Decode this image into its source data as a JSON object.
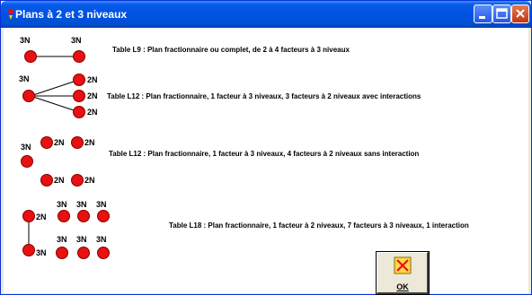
{
  "window": {
    "title": "Plans à 2 et 3 niveaux",
    "title_bar_color": "#0053e4",
    "buttons": [
      "minimize-icon",
      "maximize-icon",
      "close-icon"
    ]
  },
  "node_color": "#e81010",
  "tables": [
    {
      "description": "Table L9 : Plan  fractionnaire ou complet, de 2 à 4 facteurs à 3 niveaux",
      "labels": [
        "3N",
        "3N"
      ]
    },
    {
      "description": "Table L12 : Plan fractionnaire, 1 facteur à 3 niveaux, 3 facteurs à 2 niveaux avec interactions",
      "labels": [
        "3N",
        "2N",
        "2N",
        "2N"
      ]
    },
    {
      "description": "Table L12 : Plan fractionnaire, 1 facteur à 3 niveaux, 4 facteurs à 2 niveaux sans interaction",
      "labels": [
        "3N",
        "2N",
        "2N",
        "2N",
        "2N"
      ]
    },
    {
      "description": "Table L18 : Plan fractionnaire, 1 facteur à 2 niveaux, 7 facteurs à 3 niveaux, 1 interaction",
      "labels": [
        "2N",
        "3N",
        "3N",
        "3N",
        "3N",
        "3N",
        "3N",
        "3N"
      ]
    }
  ],
  "ok_button": {
    "label": "OK",
    "icon": "cancel-box-icon"
  }
}
